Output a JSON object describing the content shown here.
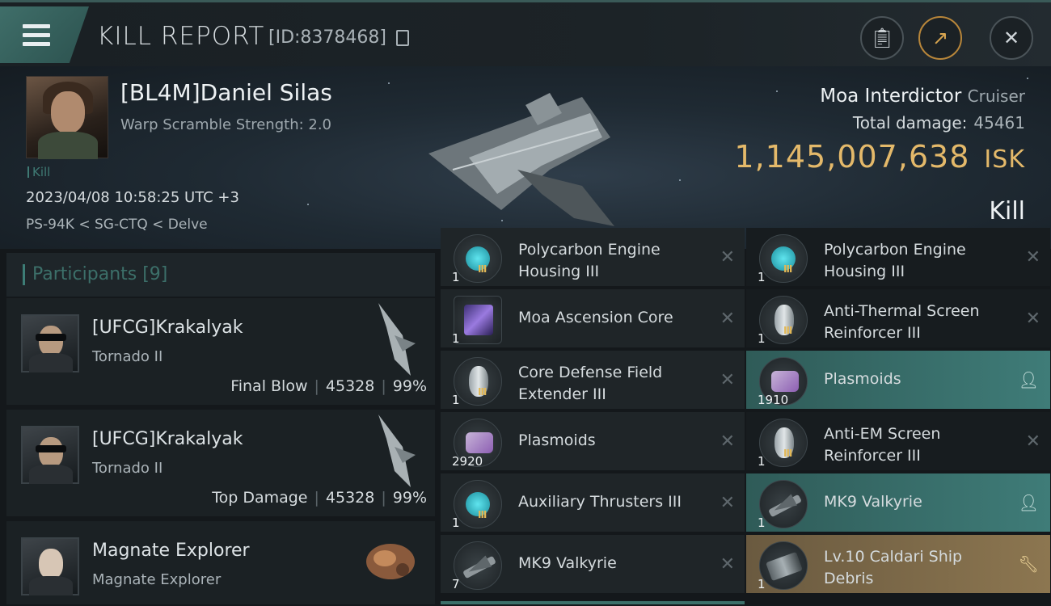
{
  "header": {
    "title": "KILL REPORT",
    "id_text": "[ID:8378468]",
    "buttons": [
      "clipboard-icon",
      "share-icon",
      "close-icon"
    ]
  },
  "victim": {
    "name": "[BL4M]Daniel Silas",
    "subtitle": "Warp Scramble Strength: 2.0",
    "tag": "Kill",
    "timestamp": "2023/04/08 10:58:25 UTC +3",
    "location": "PS-94K < SG-CTQ < Delve",
    "ship": "Moa Interdictor",
    "ship_class": "Cruiser",
    "damage_label": "Total damage:",
    "damage_value": "45461",
    "isk_value": "1,145,007,638",
    "isk_unit": "ISK",
    "result": "Kill"
  },
  "participants": {
    "header": "Participants [9]",
    "rows": [
      {
        "name": "[UFCG]Krakalyak",
        "ship": "Tornado II",
        "label": "Final Blow",
        "damage": "45328",
        "percent": "99%"
      },
      {
        "name": "[UFCG]Krakalyak",
        "ship": "Tornado II",
        "label": "Top Damage",
        "damage": "45328",
        "percent": "99%"
      },
      {
        "name": "Magnate Explorer",
        "ship": "Magnate Explorer",
        "label": "",
        "damage": "",
        "percent": ""
      }
    ]
  },
  "items_left": [
    {
      "line1": "Polycarbon Engine",
      "line2": "Housing III",
      "qty": "1",
      "level": "III",
      "icon": "module",
      "action": "destroyed",
      "style": "normal"
    },
    {
      "line1": "Moa Ascension Core",
      "line2": "",
      "qty": "1",
      "level": "",
      "icon": "core",
      "action": "destroyed",
      "style": "normal"
    },
    {
      "line1": "Core Defense Field",
      "line2": "Extender III",
      "qty": "1",
      "level": "III",
      "icon": "shield",
      "action": "destroyed",
      "style": "normal"
    },
    {
      "line1": "Plasmoids",
      "line2": "",
      "qty": "2920",
      "level": "",
      "icon": "plasmoid",
      "action": "destroyed",
      "style": "normal"
    },
    {
      "line1": "Auxiliary Thrusters III",
      "line2": "",
      "qty": "1",
      "level": "III",
      "icon": "module",
      "action": "destroyed",
      "style": "normal"
    },
    {
      "line1": "MK9  Valkyrie",
      "line2": "",
      "qty": "7",
      "level": "",
      "icon": "drone",
      "action": "destroyed",
      "style": "normal"
    }
  ],
  "items_right": [
    {
      "line1": "Polycarbon Engine",
      "line2": "Housing III",
      "qty": "1",
      "level": "III",
      "icon": "module",
      "action": "destroyed",
      "style": "dark"
    },
    {
      "line1": "Anti-Thermal Screen",
      "line2": "Reinforcer III",
      "qty": "1",
      "level": "III",
      "icon": "shield",
      "action": "destroyed",
      "style": "dark"
    },
    {
      "line1": "Plasmoids",
      "line2": "",
      "qty": "1910",
      "level": "",
      "icon": "plasmoid",
      "action": "dropped",
      "style": "teal"
    },
    {
      "line1": "Anti-EM Screen",
      "line2": "Reinforcer III",
      "qty": "1",
      "level": "III",
      "icon": "shield",
      "action": "destroyed",
      "style": "dark"
    },
    {
      "line1": "MK9  Valkyrie",
      "line2": "",
      "qty": "1",
      "level": "",
      "icon": "drone",
      "action": "dropped",
      "style": "teal"
    },
    {
      "line1": "Lv.10 Caldari Ship",
      "line2": "Debris",
      "qty": "1",
      "level": "",
      "icon": "debris",
      "action": "salvage",
      "style": "tan"
    }
  ],
  "colors": {
    "accent": "#3f7c78",
    "isk": "#e4b96a",
    "tan": "#8c7650"
  }
}
